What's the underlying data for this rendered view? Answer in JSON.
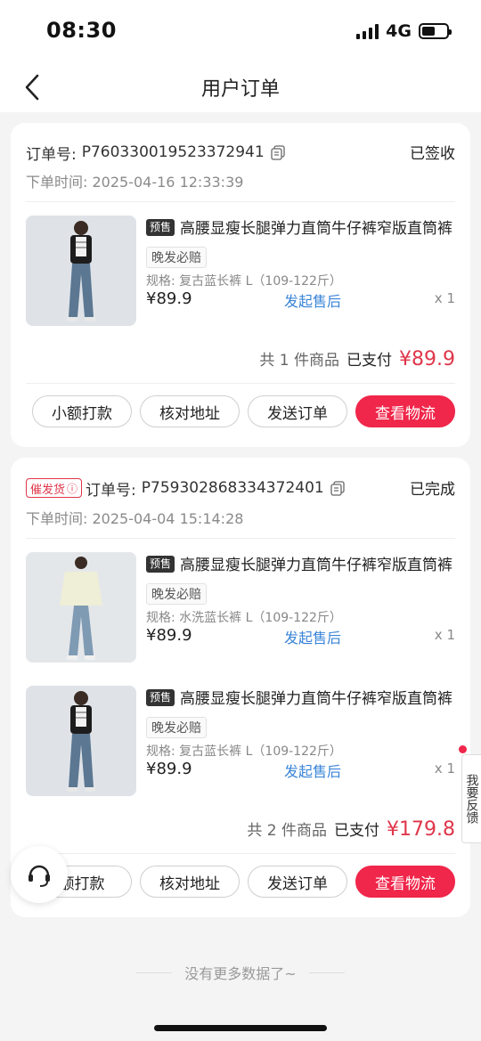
{
  "status_bar": {
    "time": "08:30",
    "network": "4G"
  },
  "header": {
    "title": "用户订单"
  },
  "orders": [
    {
      "order_no_label": "订单号:",
      "order_no": "P760330019523372941",
      "status": "已签收",
      "time_label": "下单时间:",
      "time": "2025-04-16 12:33:39",
      "items": [
        {
          "presale": "预售",
          "title": "高腰显瘦长腿弹力直筒牛仔裤窄版直筒裤",
          "guarantee": "晚发必赔",
          "spec": "规格: 复古蓝长裤 L（109-122斤）",
          "price": "¥89.9",
          "after_sale": "发起售后",
          "qty": "x 1"
        }
      ],
      "summary_count": "共 1 件商品",
      "summary_paid": "已支付",
      "summary_amount": "¥89.9",
      "actions": [
        "小额打款",
        "核对地址",
        "发送订单",
        "查看物流"
      ]
    },
    {
      "urge_badge": "催发货",
      "order_no_label": "订单号:",
      "order_no": "P759302868334372401",
      "status": "已完成",
      "time_label": "下单时间:",
      "time": "2025-04-04 15:14:28",
      "items": [
        {
          "presale": "预售",
          "title": "高腰显瘦长腿弹力直筒牛仔裤窄版直筒裤",
          "guarantee": "晚发必赔",
          "spec": "规格: 水洗蓝长裤 L（109-122斤）",
          "price": "¥89.9",
          "after_sale": "发起售后",
          "qty": "x 1"
        },
        {
          "presale": "预售",
          "title": "高腰显瘦长腿弹力直筒牛仔裤窄版直筒裤",
          "guarantee": "晚发必赔",
          "spec": "规格: 复古蓝长裤 L（109-122斤）",
          "price": "¥89.9",
          "after_sale": "发起售后",
          "qty": "x 1"
        }
      ],
      "summary_count": "共 2 件商品",
      "summary_paid": "已支付",
      "summary_amount": "¥179.8",
      "actions": [
        "额打款",
        "核对地址",
        "发送订单",
        "查看物流"
      ]
    }
  ],
  "feedback": "我要反馈",
  "no_more": "没有更多数据了~",
  "colors": {
    "accent": "#f0264a",
    "link": "#3a84d8",
    "price_red": "#e0364a"
  }
}
